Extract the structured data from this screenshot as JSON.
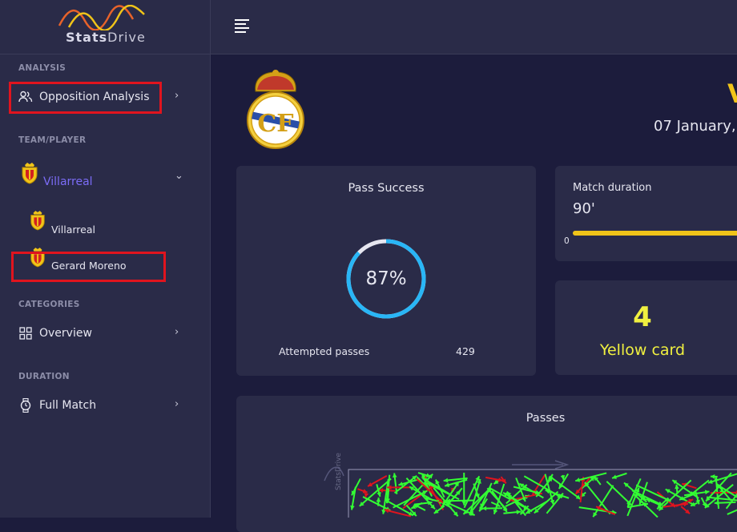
{
  "brand": {
    "name_bold": "Stats",
    "name_light": "Drive"
  },
  "sidebar": {
    "sections": [
      {
        "label": "ANALYSIS"
      },
      {
        "label": "TEAM/PLAYER"
      },
      {
        "label": "CATEGORIES"
      },
      {
        "label": "DURATION"
      }
    ],
    "opposition_analysis": "Opposition Analysis",
    "team_selected": "Villarreal",
    "sub_items": [
      "Villarreal",
      "Gerard Moreno"
    ],
    "overview": "Overview",
    "full_match": "Full Match"
  },
  "header": {
    "title": "V",
    "date": "07 January,"
  },
  "pass_success": {
    "title": "Pass Success",
    "percent_label": "87%",
    "percent": 87,
    "attempted_label": "Attempted passes",
    "attempted_value": "429"
  },
  "match_duration": {
    "title": "Match duration",
    "value": "90'",
    "start": "0",
    "progress": 1.0
  },
  "yellow_card": {
    "count": "4",
    "label": "Yellow card"
  },
  "passes": {
    "title": "Passes",
    "watermark": "StatsDrive"
  },
  "colors": {
    "accent": "#f0c419",
    "ring": "#29b6f6",
    "highlight": "#e0141e",
    "success_pass": "#33ff33",
    "failed_pass": "#e0141e",
    "link": "#7b6cf6"
  }
}
